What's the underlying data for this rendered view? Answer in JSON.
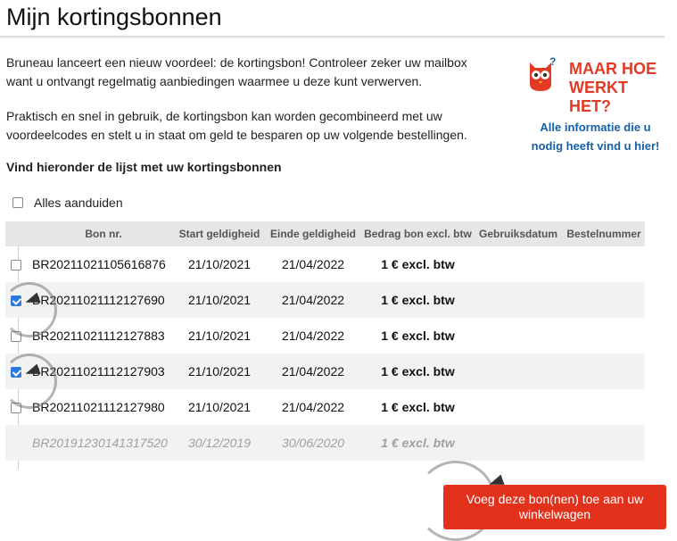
{
  "page": {
    "title": "Mijn kortingsbonnen",
    "intro_1": "Bruneau lanceert een nieuw voordeel: de kortingsbon! Controleer zeker uw mailbox want u ontvangt regelmatig aanbiedingen waarmee u deze kunt verwerven.",
    "intro_2": "Praktisch en snel in gebruik, de kortingsbon kan worden gecombineerd met uw voordeelcodes en stelt u in staat om geld te besparen op uw volgende bestellingen.",
    "list_heading": "Vind hieronder de lijst met uw kortingsbonnen",
    "select_all_label": "Alles aanduiden"
  },
  "promo": {
    "title_line1": "MAAR HOE",
    "title_line2": "WERKT HET?",
    "link_line1": "Alle informatie die u",
    "link_line2": "nodig heeft vind u hier!",
    "mascot_icon": "owl-mascot-icon",
    "accent_color": "#e23a24",
    "link_color": "#1560a8"
  },
  "table": {
    "columns": [
      "Bon nr.",
      "Start geldigheid",
      "Einde geldigheid",
      "Bedrag bon excl. btw",
      "Gebruiksdatum",
      "Bestelnummer"
    ],
    "rows": [
      {
        "bon": "BR20211021105616876",
        "start": "21/10/2021",
        "end": "21/04/2022",
        "amount": "1 € excl. btw",
        "used": "",
        "order": "",
        "checked": false,
        "expired": false
      },
      {
        "bon": "BR20211021112127690",
        "start": "21/10/2021",
        "end": "21/04/2022",
        "amount": "1 € excl. btw",
        "used": "",
        "order": "",
        "checked": true,
        "expired": false
      },
      {
        "bon": "BR20211021112127883",
        "start": "21/10/2021",
        "end": "21/04/2022",
        "amount": "1 € excl. btw",
        "used": "",
        "order": "",
        "checked": false,
        "expired": false
      },
      {
        "bon": "BR20211021112127903",
        "start": "21/10/2021",
        "end": "21/04/2022",
        "amount": "1 € excl. btw",
        "used": "",
        "order": "",
        "checked": true,
        "expired": false
      },
      {
        "bon": "BR20211021112127980",
        "start": "21/10/2021",
        "end": "21/04/2022",
        "amount": "1 € excl. btw",
        "used": "",
        "order": "",
        "checked": false,
        "expired": false
      },
      {
        "bon": "BR20191230141317520",
        "start": "30/12/2019",
        "end": "30/06/2020",
        "amount": "1 € excl. btw",
        "used": "",
        "order": "",
        "checked": false,
        "expired": true
      }
    ]
  },
  "actions": {
    "add_to_cart_label": "Voeg deze bon(nen) toe aan uw winkelwagen",
    "button_color": "#e2321c"
  }
}
